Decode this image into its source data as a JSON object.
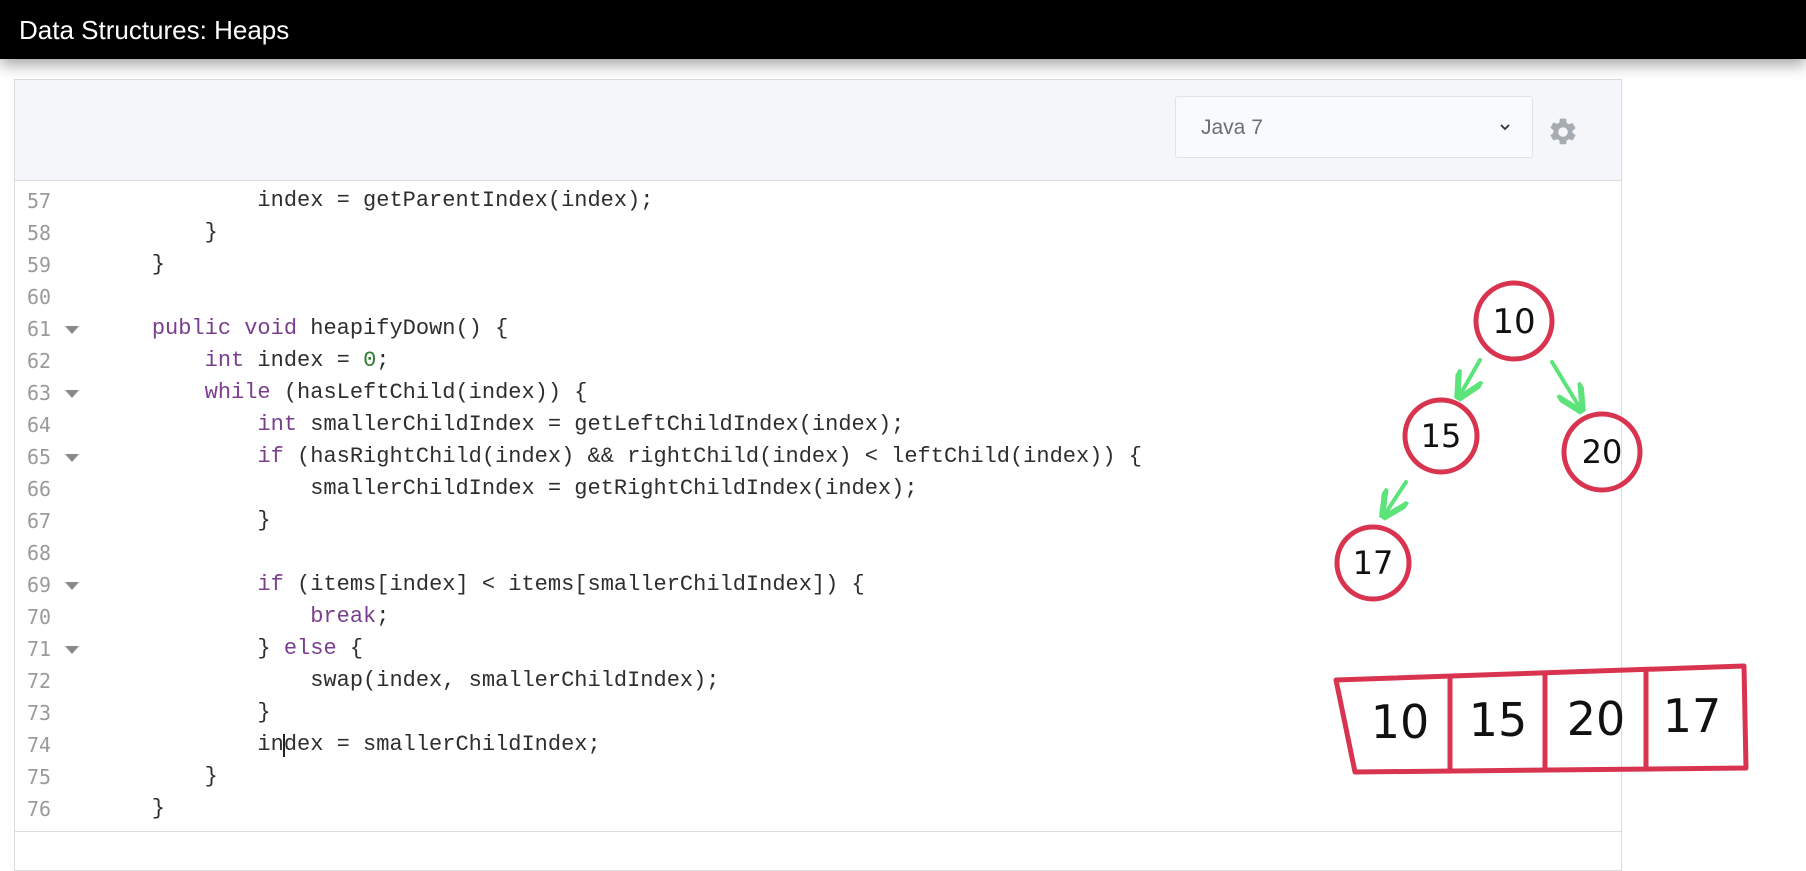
{
  "window": {
    "title": "Data Structures: Heaps"
  },
  "toolbar": {
    "language_selected": "Java 7",
    "chevron_icon": "chevron-down-icon",
    "settings_icon": "gear-icon"
  },
  "editor": {
    "lines": [
      {
        "n": "57",
        "fold": false,
        "code": "            index = getParentIndex(index);"
      },
      {
        "n": "58",
        "fold": false,
        "code": "        }"
      },
      {
        "n": "59",
        "fold": false,
        "code": "    }"
      },
      {
        "n": "60",
        "fold": false,
        "code": ""
      },
      {
        "n": "61",
        "fold": true,
        "code": "    public void heapifyDown() {"
      },
      {
        "n": "62",
        "fold": false,
        "code": "        int index = 0;"
      },
      {
        "n": "63",
        "fold": true,
        "code": "        while (hasLeftChild(index)) {"
      },
      {
        "n": "64",
        "fold": false,
        "code": "            int smallerChildIndex = getLeftChildIndex(index);"
      },
      {
        "n": "65",
        "fold": true,
        "code": "            if (hasRightChild(index) && rightChild(index) < leftChild(index)) {"
      },
      {
        "n": "66",
        "fold": false,
        "code": "                smallerChildIndex = getRightChildIndex(index);"
      },
      {
        "n": "67",
        "fold": false,
        "code": "            }"
      },
      {
        "n": "68",
        "fold": false,
        "code": ""
      },
      {
        "n": "69",
        "fold": true,
        "code": "            if (items[index] < items[smallerChildIndex]) {"
      },
      {
        "n": "70",
        "fold": false,
        "code": "                break;"
      },
      {
        "n": "71",
        "fold": true,
        "code": "            } else {"
      },
      {
        "n": "72",
        "fold": false,
        "code": "                swap(index, smallerChildIndex);"
      },
      {
        "n": "73",
        "fold": false,
        "code": "            }"
      },
      {
        "n": "74",
        "fold": false,
        "code": "            index = smallerChildIndex;"
      },
      {
        "n": "75",
        "fold": false,
        "code": "        }"
      },
      {
        "n": "76",
        "fold": false,
        "code": "    }"
      }
    ]
  },
  "heap_drawing": {
    "tree_nodes": [
      "10",
      "15",
      "20",
      "17"
    ],
    "array_cells": [
      "10",
      "15",
      "20",
      "17"
    ],
    "node_color": "#d9344f",
    "arrow_color": "#5ce37a"
  }
}
